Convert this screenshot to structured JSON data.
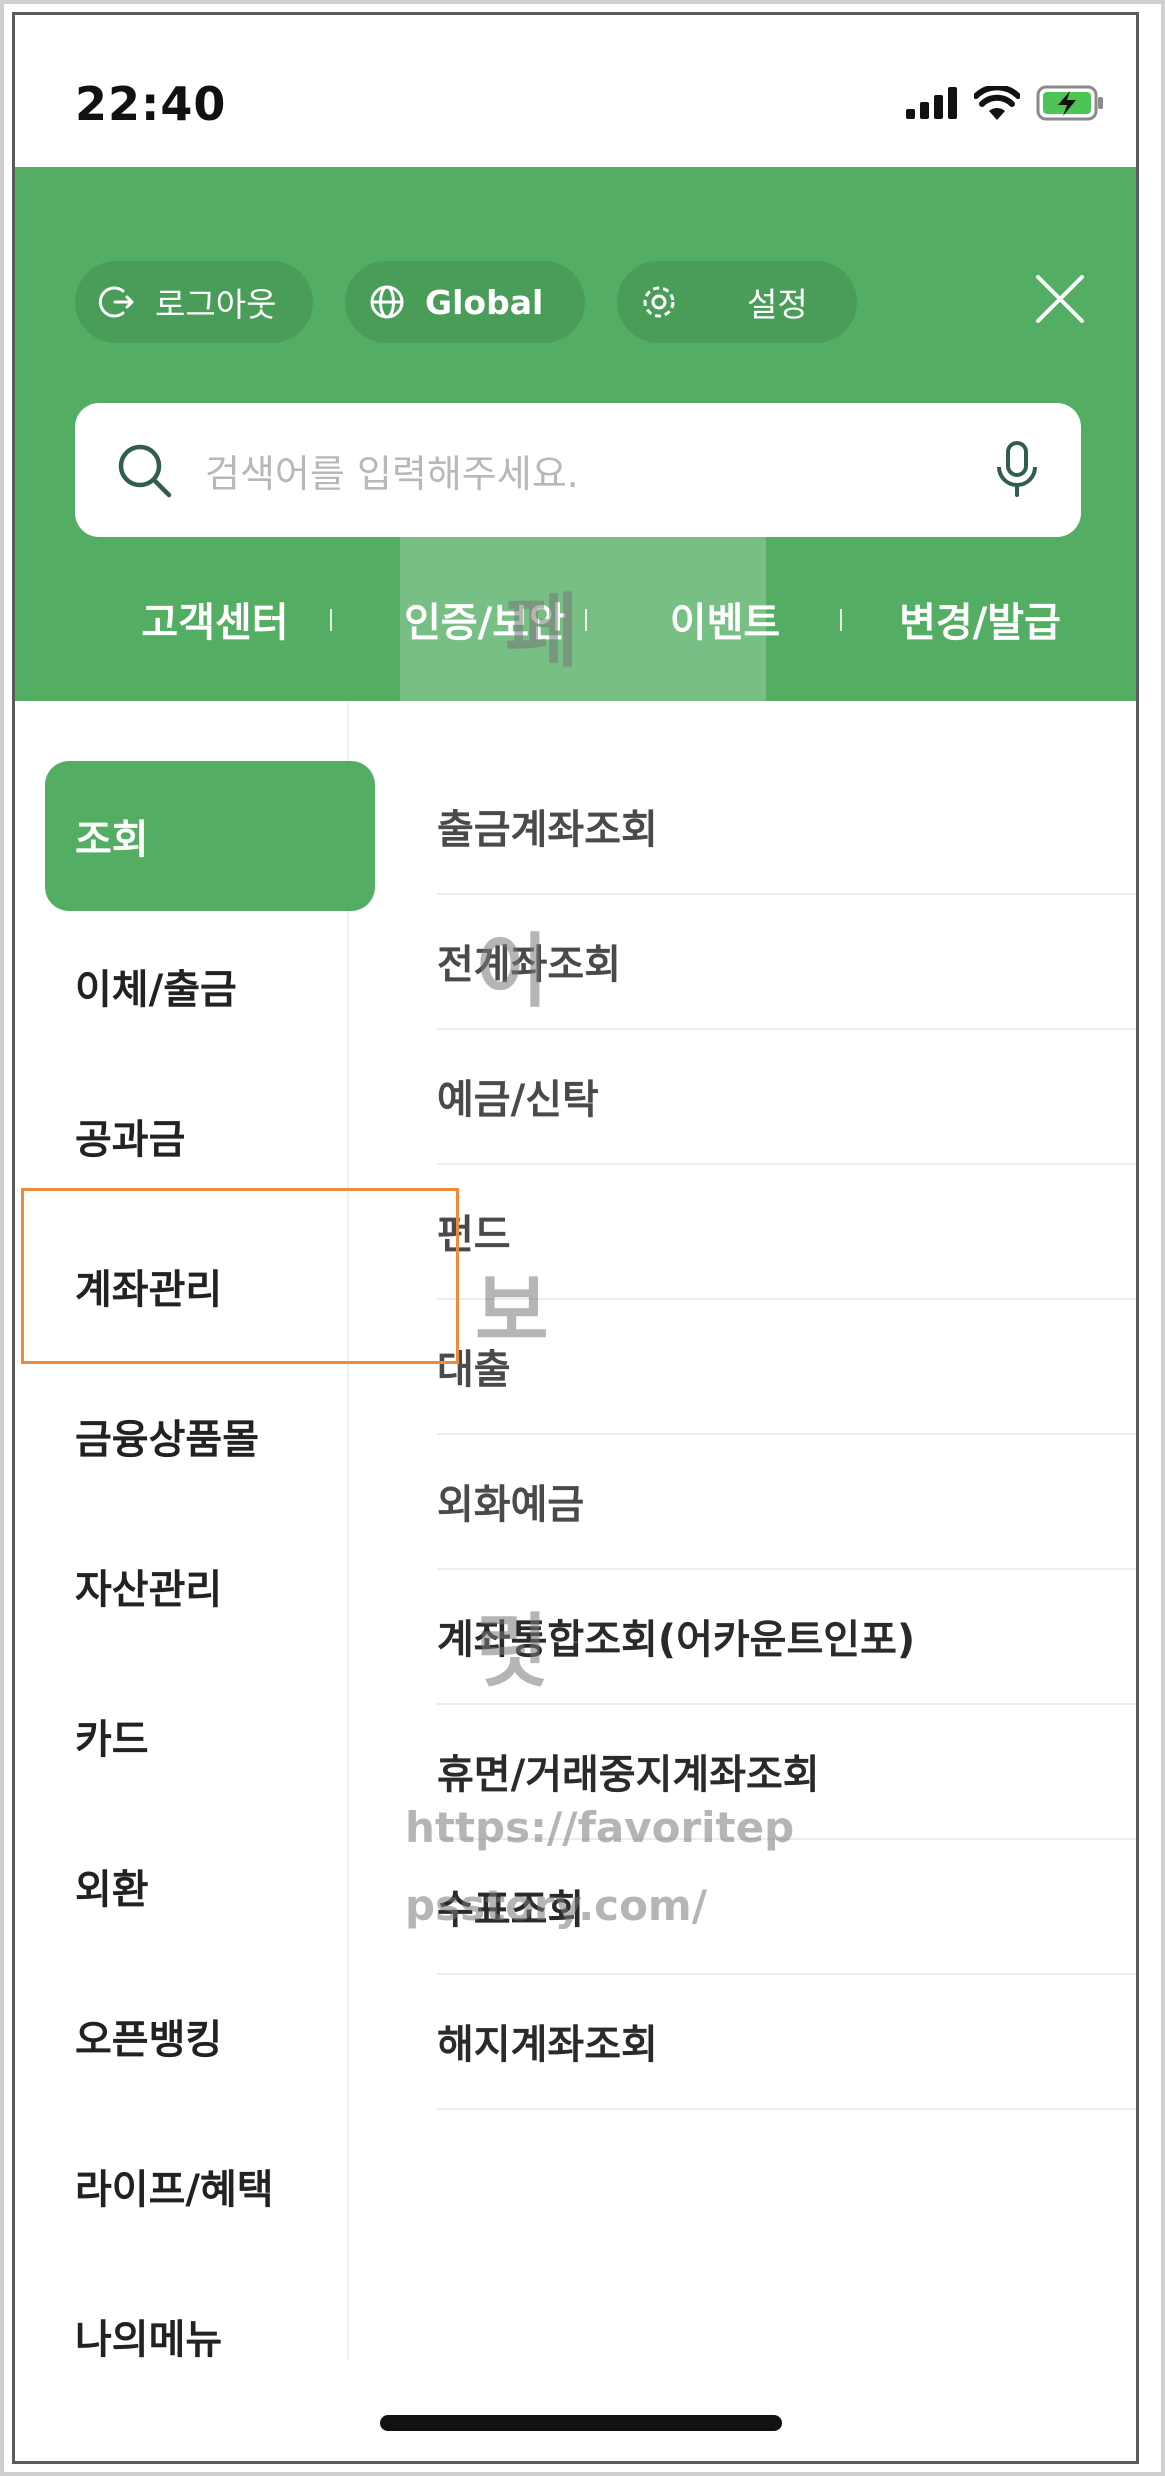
{
  "status_bar": {
    "time": "22:40"
  },
  "header": {
    "logout_label": "로그아웃",
    "global_label": "Global",
    "settings_label": "설정"
  },
  "search": {
    "placeholder": "검색어를 입력해주세요."
  },
  "quick_links": [
    "고객센터",
    "인증/보안",
    "이벤트",
    "변경/발급"
  ],
  "left_menu": [
    "조회",
    "이체/출금",
    "공과금",
    "계좌관리",
    "금융상품몰",
    "자산관리",
    "카드",
    "외환",
    "오픈뱅킹",
    "라이프/혜택",
    "나의메뉴"
  ],
  "sub_menu": [
    "출금계좌조회",
    "전계좌조회",
    "예금/신탁",
    "펀드",
    "대출",
    "외화예금",
    "계좌통합조회(어카운트인포)",
    "휴면/거래중지계좌조회",
    "수표조회",
    "해지계좌조회"
  ],
  "watermark": {
    "chars": [
      "페",
      "이",
      "보",
      "릿"
    ],
    "url_line1": "https://favoritep",
    "url_line2": "psstory.com/"
  },
  "colors": {
    "accent": "#53ae63",
    "highlight_box": "#ef8a3b"
  },
  "icons": [
    "logout-icon",
    "globe-icon",
    "gear-icon",
    "close-icon",
    "search-icon",
    "mic-icon",
    "signal-icon",
    "wifi-icon",
    "battery-charging-icon"
  ]
}
